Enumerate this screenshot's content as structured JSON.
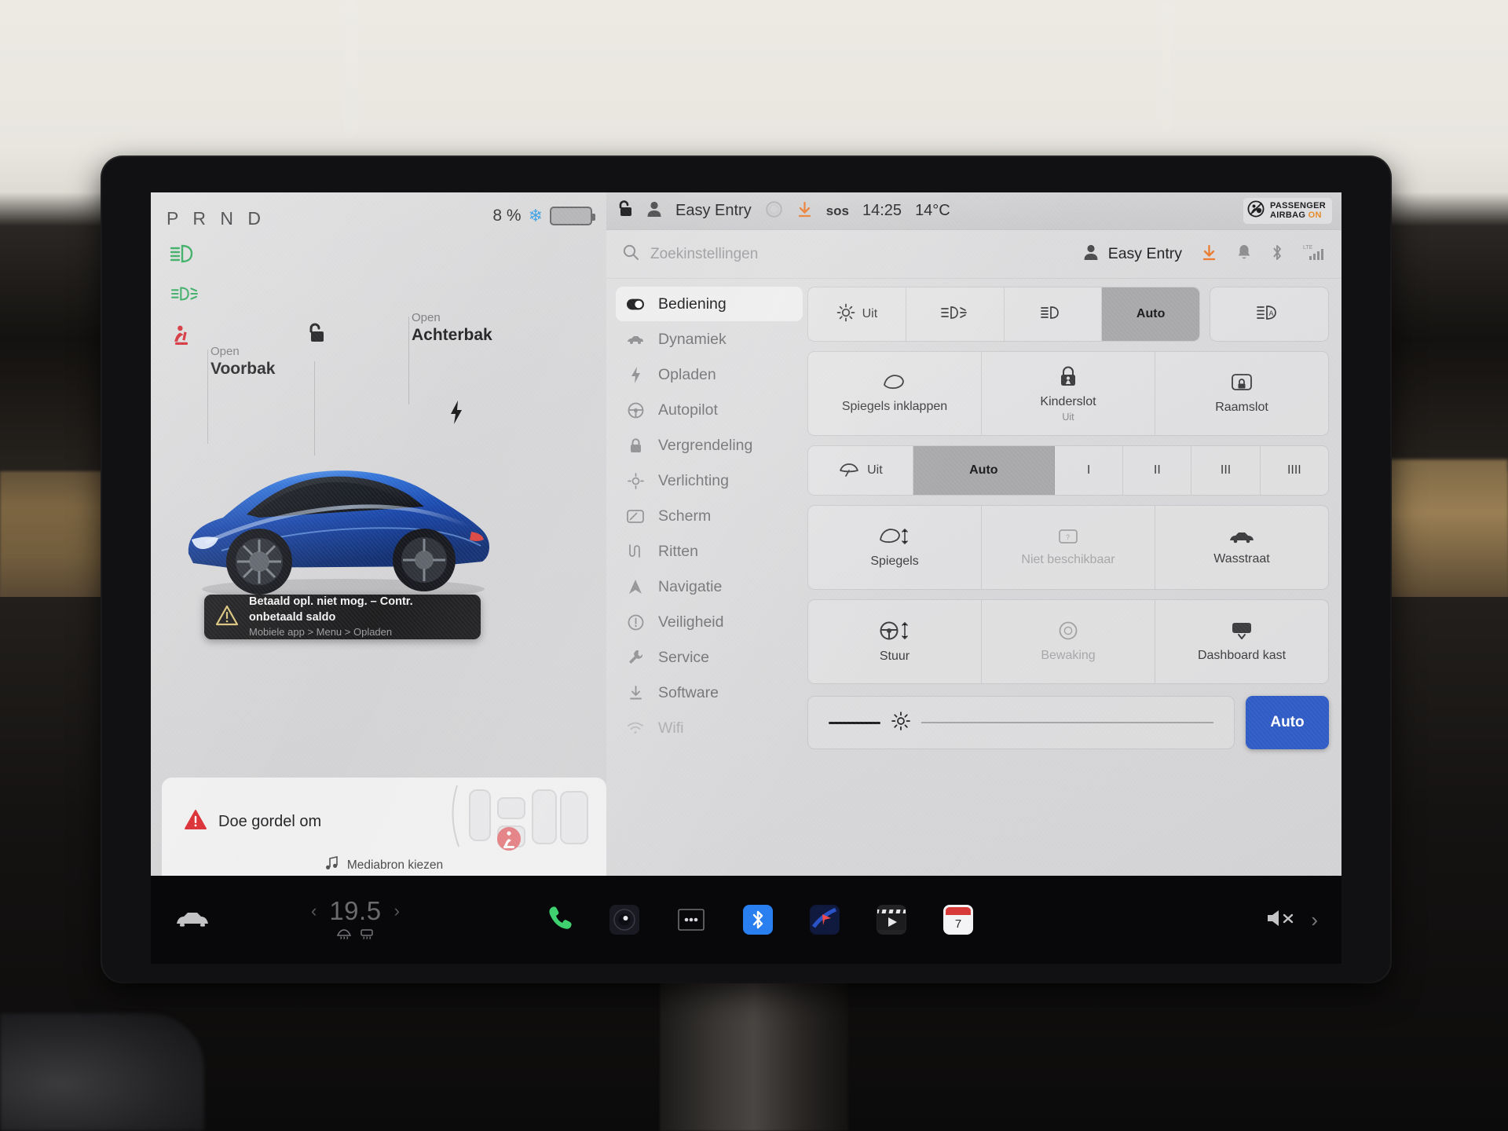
{
  "car_pane": {
    "gear_indicator": "P R N D",
    "battery": {
      "percent": "8 %",
      "cold_icon": "snowflake-icon"
    },
    "tell_tales": [
      {
        "name": "low-beam-indicator",
        "color": "#24a352"
      },
      {
        "name": "fog-light-indicator",
        "color": "#24a352"
      },
      {
        "name": "seatbelt-indicator",
        "color": "#d0202a"
      }
    ],
    "hotspots": [
      {
        "sub": "Open",
        "main": "Voorbak"
      },
      {
        "sub": "Open",
        "main": "Achterbak"
      }
    ],
    "lock_icon": "unlocked-padlock-icon",
    "charge_icon": "charge-bolt-icon",
    "notification": {
      "icon": "warning-triangle-icon",
      "title": "Betaald opl. niet mog. – Contr. onbetaald saldo",
      "subtitle": "Mobiele app > Menu > Opladen"
    },
    "seatbelt_card": {
      "icon": "red-warning-triangle-icon",
      "text": "Doe gordel om",
      "diagram": "seat-occupancy-diagram"
    },
    "media_bar": {
      "icon": "music-note-icon",
      "label": "Mediabron kiezen"
    }
  },
  "top_bar": {
    "lock_icon": "unlocked-padlock-icon",
    "profile_icon": "person-icon",
    "profile_name": "Easy Entry",
    "ring_icon": "steering-ring-icon",
    "download_icon": "software-download-icon",
    "sos_label": "sos",
    "time": "14:25",
    "temperature": "14°C",
    "airbag": {
      "icon": "passenger-airbag-off-icon",
      "line1": "PASSENGER",
      "line2": "AIRBAG",
      "status": "ON",
      "status_color": "#e58a26"
    }
  },
  "search_row": {
    "search_icon": "search-icon",
    "placeholder": "Zoekinstellingen",
    "profile_icon": "person-icon",
    "profile_name": "Easy Entry",
    "icons": [
      {
        "name": "software-download-icon"
      },
      {
        "name": "bell-icon"
      },
      {
        "name": "bluetooth-icon"
      },
      {
        "name": "lte-signal-icon",
        "label": "LTE"
      }
    ]
  },
  "menu": {
    "items": [
      {
        "label": "Bediening",
        "icon": "toggle-switch-icon",
        "selected": true
      },
      {
        "label": "Dynamiek",
        "icon": "car-side-icon",
        "selected": false
      },
      {
        "label": "Opladen",
        "icon": "bolt-icon",
        "selected": false
      },
      {
        "label": "Autopilot",
        "icon": "steering-wheel-icon",
        "selected": false
      },
      {
        "label": "Vergrendeling",
        "icon": "padlock-icon",
        "selected": false
      },
      {
        "label": "Verlichting",
        "icon": "sun-icon",
        "selected": false
      },
      {
        "label": "Scherm",
        "icon": "display-icon",
        "selected": false
      },
      {
        "label": "Ritten",
        "icon": "trips-icon",
        "selected": false
      },
      {
        "label": "Navigatie",
        "icon": "navigation-arrow-icon",
        "selected": false
      },
      {
        "label": "Veiligheid",
        "icon": "exclamation-circle-icon",
        "selected": false
      },
      {
        "label": "Service",
        "icon": "wrench-icon",
        "selected": false
      },
      {
        "label": "Software",
        "icon": "download-icon",
        "selected": false
      },
      {
        "label": "Wifi",
        "icon": "wifi-icon",
        "selected": false,
        "cut_off": true
      }
    ]
  },
  "controls": {
    "lights_row": {
      "options": [
        {
          "label": "Uit",
          "icon": "sun-off-icon",
          "selected": false
        },
        {
          "label": "",
          "icon": "fog-lamp-icon",
          "selected": false
        },
        {
          "label": "",
          "icon": "low-beam-icon",
          "selected": false
        },
        {
          "label": "Auto",
          "icon": "",
          "selected": true
        }
      ],
      "extra": {
        "label": "",
        "icon": "auto-high-beam-icon",
        "selected": false
      }
    },
    "tiles_row_1": [
      {
        "label": "Spiegels inklappen",
        "icon": "mirror-fold-icon",
        "sub": "",
        "disabled": false
      },
      {
        "label": "Kinderslot",
        "icon": "child-lock-icon",
        "sub": "Uit",
        "disabled": false
      },
      {
        "label": "Raamslot",
        "icon": "window-lock-icon",
        "sub": "",
        "disabled": false
      }
    ],
    "wiper_row": [
      {
        "label": "Uit",
        "icon": "wiper-icon",
        "selected": false
      },
      {
        "label": "Auto",
        "icon": "",
        "selected": true
      },
      {
        "label": "I",
        "icon": "",
        "selected": false
      },
      {
        "label": "II",
        "icon": "",
        "selected": false
      },
      {
        "label": "III",
        "icon": "",
        "selected": false
      },
      {
        "label": "IIII",
        "icon": "",
        "selected": false
      }
    ],
    "tiles_row_2": [
      {
        "label": "Spiegels",
        "icon": "mirror-adjust-icon",
        "disabled": false
      },
      {
        "label": "Niet beschikbaar",
        "icon": "unavailable-icon",
        "disabled": true
      },
      {
        "label": "Wasstraat",
        "icon": "car-wash-icon",
        "disabled": false
      }
    ],
    "tiles_row_3": [
      {
        "label": "Stuur",
        "icon": "steering-adjust-icon",
        "disabled": false
      },
      {
        "label": "Bewaking",
        "icon": "sentry-mode-icon",
        "disabled": true
      },
      {
        "label": "Dashboard kast",
        "icon": "glovebox-icon",
        "disabled": false
      }
    ],
    "brightness": {
      "icon": "brightness-sun-icon",
      "value_percent": 20,
      "auto_label": "Auto",
      "auto_color": "#2f5bc4"
    }
  },
  "dock": {
    "car_icon": "car-front-icon",
    "temperature": "19.5",
    "left_chevron": "chevron-left-icon",
    "right_chevron": "chevron-right-icon",
    "defrost_icons": [
      "front-defrost-icon",
      "rear-defrost-icon"
    ],
    "apps": [
      {
        "name": "phone-icon",
        "color": "#3fd070"
      },
      {
        "name": "camera-lens-icon",
        "color": "#2a2a34"
      },
      {
        "name": "more-apps-icon",
        "color": "#cfcfd2"
      },
      {
        "name": "bluetooth-app-icon",
        "color": "#2a7ff0"
      },
      {
        "name": "navigation-app-icon",
        "color": "#1b2a5c"
      },
      {
        "name": "media-player-icon",
        "color": "#2b2b2d"
      },
      {
        "name": "calendar-app-icon",
        "color": "#d83a3a",
        "day": "7"
      }
    ],
    "volume": {
      "mute_icon": "volume-mute-icon",
      "chevron": "chevron-right-icon"
    }
  }
}
